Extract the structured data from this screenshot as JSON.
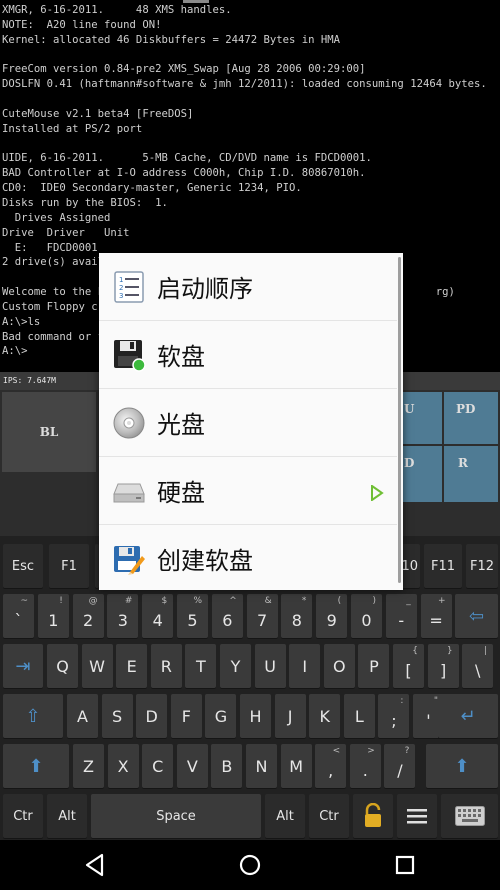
{
  "terminal": {
    "lines": [
      "XMGR, 6-16-2011.     48 XMS handles.",
      "NOTE:  A20 line found ON!",
      "Kernel: allocated 46 Diskbuffers = 24472 Bytes in HMA",
      "",
      "FreeCom version 0.84-pre2 XMS_Swap [Aug 28 2006 00:29:00]",
      "DOSLFN 0.41 (haftmann#software & jmh 12/2011): loaded consuming 12464 bytes.",
      "",
      "CuteMouse v2.1 beta4 [FreeDOS]",
      "Installed at PS/2 port",
      "",
      "UIDE, 6-16-2011.      5-MB Cache, CD/DVD name is FDCD0001.",
      "BAD Controller at I-O address C000h, Chip I.D. 80867010h.",
      "CD0:  IDE0 Secondary-master, Generic 1234, PIO.",
      "Disks run by the BIOS:  1.",
      "  Drives Assigned",
      "Drive  Driver   Unit",
      "  E:   FDCD0001",
      "2 drive(s) avail",
      "",
      "Welcome to the F                                                    rg)",
      "Custom Floppy cr",
      "A:\\>ls",
      "Bad command or f",
      "A:\\>"
    ]
  },
  "status": {
    "ips": "IPS: 7.647M"
  },
  "pads": {
    "bl": "BL",
    "u": "U",
    "pd": "PD",
    "d": "D",
    "r": "R"
  },
  "menu": {
    "items": [
      {
        "label": "启动顺序",
        "icon": "list-icon"
      },
      {
        "label": "软盘",
        "icon": "floppy-icon"
      },
      {
        "label": "光盘",
        "icon": "cd-icon"
      },
      {
        "label": "硬盘",
        "icon": "hard-disk-icon",
        "has_submenu": true
      },
      {
        "label": "创建软盘",
        "icon": "create-floppy-icon"
      }
    ]
  },
  "keyboard": {
    "row1": [
      "Esc",
      "F1",
      "F10",
      "F11",
      "F12"
    ],
    "row2": [
      {
        "sub": "~",
        "main": "`"
      },
      {
        "sub": "!",
        "main": "1"
      },
      {
        "sub": "@",
        "main": "2"
      },
      {
        "sub": "#",
        "main": "3"
      },
      {
        "sub": "$",
        "main": "4"
      },
      {
        "sub": "%",
        "main": "5"
      },
      {
        "sub": "^",
        "main": "6"
      },
      {
        "sub": "&",
        "main": "7"
      },
      {
        "sub": "*",
        "main": "8"
      },
      {
        "sub": "(",
        "main": "9"
      },
      {
        "sub": ")",
        "main": "0"
      },
      {
        "sub": "_",
        "main": "-"
      },
      {
        "sub": "+",
        "main": "="
      }
    ],
    "row3": [
      {
        "sub": "",
        "main": "Q"
      },
      {
        "sub": "",
        "main": "W"
      },
      {
        "sub": "",
        "main": "E"
      },
      {
        "sub": "",
        "main": "R"
      },
      {
        "sub": "",
        "main": "T"
      },
      {
        "sub": "",
        "main": "Y"
      },
      {
        "sub": "",
        "main": "U"
      },
      {
        "sub": "",
        "main": "I"
      },
      {
        "sub": "",
        "main": "O"
      },
      {
        "sub": "",
        "main": "P"
      },
      {
        "sub": "{",
        "main": "["
      },
      {
        "sub": "}",
        "main": "]"
      },
      {
        "sub": "|",
        "main": "\\"
      }
    ],
    "row4": [
      {
        "sub": "",
        "main": "A"
      },
      {
        "sub": "",
        "main": "S"
      },
      {
        "sub": "",
        "main": "D"
      },
      {
        "sub": "",
        "main": "F"
      },
      {
        "sub": "",
        "main": "G"
      },
      {
        "sub": "",
        "main": "H"
      },
      {
        "sub": "",
        "main": "J"
      },
      {
        "sub": "",
        "main": "K"
      },
      {
        "sub": "",
        "main": "L"
      },
      {
        "sub": ":",
        "main": ";"
      },
      {
        "sub": "\"",
        "main": "'"
      }
    ],
    "row5": [
      {
        "sub": "",
        "main": "Z"
      },
      {
        "sub": "",
        "main": "X"
      },
      {
        "sub": "",
        "main": "C"
      },
      {
        "sub": "",
        "main": "V"
      },
      {
        "sub": "",
        "main": "B"
      },
      {
        "sub": "",
        "main": "N"
      },
      {
        "sub": "",
        "main": "M"
      },
      {
        "sub": "<",
        "main": ","
      },
      {
        "sub": ">",
        "main": "."
      },
      {
        "sub": "?",
        "main": "/"
      }
    ],
    "row6": {
      "ctrl": "Ctr",
      "alt": "Alt",
      "space": "Space"
    }
  }
}
